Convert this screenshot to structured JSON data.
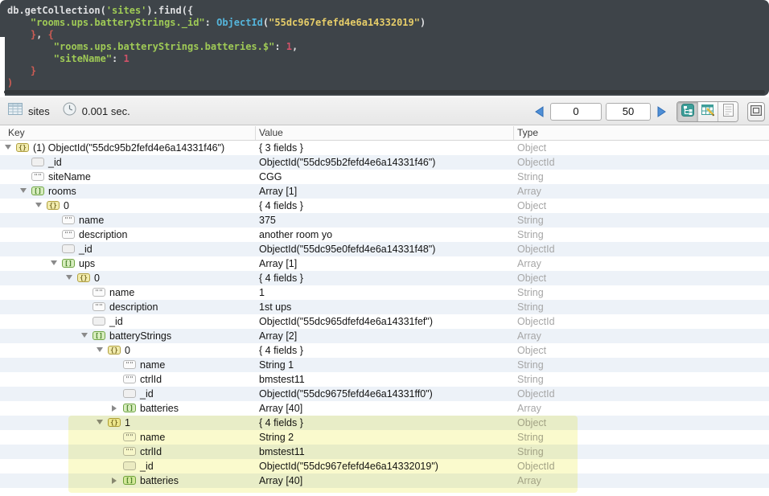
{
  "editor": {
    "code_lines": [
      [
        {
          "t": "db.getCollection(",
          "c": "tp"
        },
        {
          "t": "'sites'",
          "c": "tk"
        },
        {
          "t": ").find({",
          "c": "tp"
        }
      ],
      [
        {
          "t": "    ",
          "c": "tp"
        },
        {
          "t": "\"rooms.ups.batteryStrings._id\"",
          "c": "tk"
        },
        {
          "t": ": ",
          "c": "tp"
        },
        {
          "t": "ObjectId",
          "c": "tc"
        },
        {
          "t": "(",
          "c": "tp"
        },
        {
          "t": "\"55dc967efefd4e6a14332019\"",
          "c": "ts"
        },
        {
          "t": ")",
          "c": "tp"
        }
      ],
      [
        {
          "t": "    ",
          "c": "tp"
        },
        {
          "t": "}",
          "c": "tb"
        },
        {
          "t": ", ",
          "c": "tp"
        },
        {
          "t": "{",
          "c": "tb"
        }
      ],
      [
        {
          "t": "        ",
          "c": "tp"
        },
        {
          "t": "\"rooms.ups.batteryStrings.batteries.$\"",
          "c": "tk"
        },
        {
          "t": ": ",
          "c": "tp"
        },
        {
          "t": "1",
          "c": "tn"
        },
        {
          "t": ",",
          "c": "tp"
        }
      ],
      [
        {
          "t": "        ",
          "c": "tp"
        },
        {
          "t": "\"siteName\"",
          "c": "tk"
        },
        {
          "t": ": ",
          "c": "tp"
        },
        {
          "t": "1",
          "c": "tn"
        }
      ],
      [
        {
          "t": "    ",
          "c": "tp"
        },
        {
          "t": "}",
          "c": "tb"
        }
      ],
      [
        {
          "t": ")",
          "c": "tb"
        }
      ]
    ]
  },
  "toolbar": {
    "collection_tab": "sites",
    "query_time": "0.001 sec.",
    "skip_value": "0",
    "limit_value": "50",
    "icons": {
      "collection": "grid-icon",
      "time": "clock-icon",
      "prev": "prev-page-icon",
      "next": "next-page-icon",
      "mode_tree": "tree-view-icon",
      "mode_table": "table-view-icon",
      "mode_text": "text-view-icon",
      "expand": "custom-view-icon"
    }
  },
  "results_table": {
    "columns": [
      "Key",
      "Value",
      "Type"
    ],
    "rows": [
      {
        "key": "(1) ObjectId(\"55dc95b2fefd4e6a14331f46\")",
        "value": "{ 3 fields }",
        "type": "Object",
        "level": 0,
        "icon": "object",
        "expander": "open",
        "highlighted": false
      },
      {
        "key": "_id",
        "value": "ObjectId(\"55dc95b2fefd4e6a14331f46\")",
        "type": "ObjectId",
        "level": 1,
        "icon": "id",
        "expander": "none",
        "highlighted": false
      },
      {
        "key": "siteName",
        "value": "CGG",
        "type": "String",
        "level": 1,
        "icon": "string",
        "expander": "none",
        "highlighted": false
      },
      {
        "key": "rooms",
        "value": "Array [1]",
        "type": "Array",
        "level": 1,
        "icon": "array",
        "expander": "open",
        "highlighted": false
      },
      {
        "key": "0",
        "value": "{ 4 fields }",
        "type": "Object",
        "level": 2,
        "icon": "object",
        "expander": "open",
        "highlighted": false
      },
      {
        "key": "name",
        "value": "375",
        "type": "String",
        "level": 3,
        "icon": "string",
        "expander": "none",
        "highlighted": false
      },
      {
        "key": "description",
        "value": "another room yo",
        "type": "String",
        "level": 3,
        "icon": "string",
        "expander": "none",
        "highlighted": false
      },
      {
        "key": "_id",
        "value": "ObjectId(\"55dc95e0fefd4e6a14331f48\")",
        "type": "ObjectId",
        "level": 3,
        "icon": "id",
        "expander": "none",
        "highlighted": false
      },
      {
        "key": "ups",
        "value": "Array [1]",
        "type": "Array",
        "level": 3,
        "icon": "array",
        "expander": "open",
        "highlighted": false
      },
      {
        "key": "0",
        "value": "{ 4 fields }",
        "type": "Object",
        "level": 4,
        "icon": "object",
        "expander": "open",
        "highlighted": false
      },
      {
        "key": "name",
        "value": "1",
        "type": "String",
        "level": 5,
        "icon": "string",
        "expander": "none",
        "highlighted": false
      },
      {
        "key": "description",
        "value": "1st ups",
        "type": "String",
        "level": 5,
        "icon": "string",
        "expander": "none",
        "highlighted": false
      },
      {
        "key": "_id",
        "value": "ObjectId(\"55dc965dfefd4e6a14331fef\")",
        "type": "ObjectId",
        "level": 5,
        "icon": "id",
        "expander": "none",
        "highlighted": false
      },
      {
        "key": "batteryStrings",
        "value": "Array [2]",
        "type": "Array",
        "level": 5,
        "icon": "array",
        "expander": "open",
        "highlighted": false
      },
      {
        "key": "0",
        "value": "{ 4 fields }",
        "type": "Object",
        "level": 6,
        "icon": "object",
        "expander": "open",
        "highlighted": false
      },
      {
        "key": "name",
        "value": "String 1",
        "type": "String",
        "level": 7,
        "icon": "string",
        "expander": "none",
        "highlighted": false
      },
      {
        "key": "ctrlId",
        "value": "bmstest11",
        "type": "String",
        "level": 7,
        "icon": "string",
        "expander": "none",
        "highlighted": false
      },
      {
        "key": "_id",
        "value": "ObjectId(\"55dc9675fefd4e6a14331ff0\")",
        "type": "ObjectId",
        "level": 7,
        "icon": "id",
        "expander": "none",
        "highlighted": false
      },
      {
        "key": "batteries",
        "value": "Array [40]",
        "type": "Array",
        "level": 7,
        "icon": "array",
        "expander": "closed",
        "highlighted": false
      },
      {
        "key": "1",
        "value": "{ 4 fields }",
        "type": "Object",
        "level": 6,
        "icon": "object",
        "expander": "open",
        "highlighted": true
      },
      {
        "key": "name",
        "value": "String 2",
        "type": "String",
        "level": 7,
        "icon": "string",
        "expander": "none",
        "highlighted": true
      },
      {
        "key": "ctrlId",
        "value": "bmstest11",
        "type": "String",
        "level": 7,
        "icon": "string",
        "expander": "none",
        "highlighted": true
      },
      {
        "key": "_id",
        "value": "ObjectId(\"55dc967efefd4e6a14332019\")",
        "type": "ObjectId",
        "level": 7,
        "icon": "id",
        "expander": "none",
        "highlighted": true
      },
      {
        "key": "batteries",
        "value": "Array [40]",
        "type": "Array",
        "level": 7,
        "icon": "array",
        "expander": "closed",
        "highlighted": true
      }
    ],
    "icon_glyphs": {
      "object": "{}",
      "array": "[]",
      "string": "\"\"",
      "id": ""
    }
  },
  "colors": {
    "editor_bg": "#3e4449",
    "token_plain": "#dfe0e2",
    "token_key": "#9fca56",
    "token_string": "#e6cd69",
    "token_class": "#55b5db",
    "token_brace": "#cd5c54",
    "token_number": "#cf5268",
    "row_alternate": "#edf2f8",
    "type_text": "#a6a6a6",
    "highlight_yellow": "#fafacd",
    "view_icon_teal": "#3d9e99",
    "pagination_arrow_blue": "#4f8fd6"
  }
}
